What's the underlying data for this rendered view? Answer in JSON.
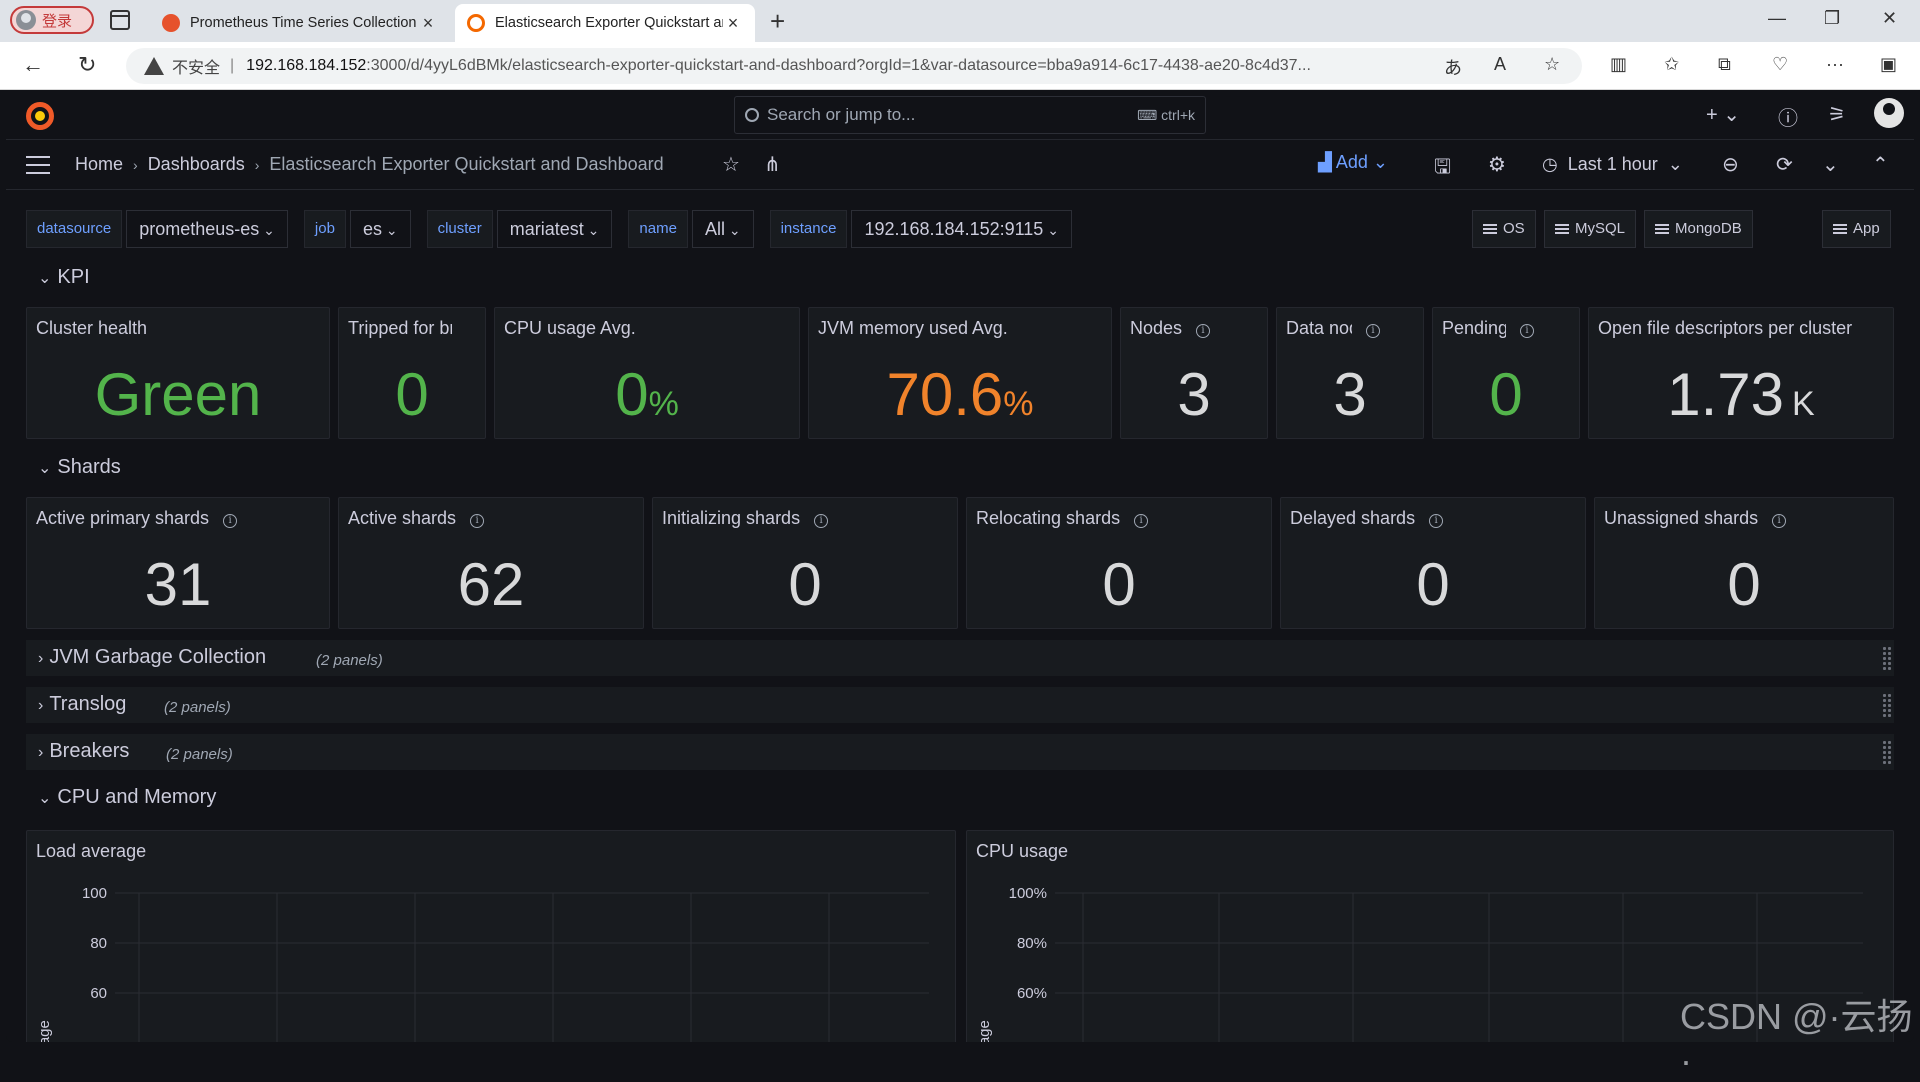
{
  "browser": {
    "profile_label": "登录",
    "tabs": [
      {
        "title": "Prometheus Time Series Collection"
      },
      {
        "title": "Elasticsearch Exporter Quickstart and Dashboard"
      }
    ],
    "insecure_label": "不安全",
    "url_host": "192.168.184.152",
    "url_rest": ":3000/d/4yyL6dBMk/elasticsearch-exporter-quickstart-and-dashboard?orgId=1&var-datasource=bba9a914-6c17-4438-ae20-8c4d37..."
  },
  "grafana": {
    "search_placeholder": "Search or jump to...",
    "search_shortcut": "ctrl+k",
    "breadcrumb": [
      "Home",
      "Dashboards",
      "Elasticsearch Exporter Quickstart and Dashboard"
    ],
    "add_label": "Add",
    "time_range": "Last 1 hour"
  },
  "variables": [
    {
      "label": "datasource",
      "value": "prometheus-es"
    },
    {
      "label": "job",
      "value": "es"
    },
    {
      "label": "cluster",
      "value": "mariatest"
    },
    {
      "label": "name",
      "value": "All"
    },
    {
      "label": "instance",
      "value": "192.168.184.152:9115"
    }
  ],
  "links": [
    "OS",
    "MySQL",
    "MongoDB",
    "App"
  ],
  "rows": {
    "kpi": "KPI",
    "shards": "Shards",
    "jvm": {
      "title": "JVM Garbage Collection",
      "count": "(2 panels)"
    },
    "translog": {
      "title": "Translog",
      "count": "(2 panels)"
    },
    "breakers": {
      "title": "Breakers",
      "count": "(2 panels)"
    },
    "cpu": "CPU and Memory"
  },
  "kpi_panels": [
    {
      "title": "Cluster health",
      "value": "Green",
      "unit": "",
      "color": "#53b44b"
    },
    {
      "title": "Tripped for breakers",
      "value": "0",
      "unit": "",
      "color": "#53b44b"
    },
    {
      "title": "CPU usage Avg.",
      "value": "0",
      "unit": "%",
      "color": "#53b44b"
    },
    {
      "title": "JVM memory used Avg.",
      "value": "70.6",
      "unit": "%",
      "color": "#f0832b"
    },
    {
      "title": "Nodes",
      "value": "3",
      "unit": "",
      "color": "#d8d9da"
    },
    {
      "title": "Data nodes",
      "value": "3",
      "unit": "",
      "color": "#d8d9da"
    },
    {
      "title": "Pending tasks",
      "value": "0",
      "unit": "",
      "color": "#53b44b"
    },
    {
      "title": "Open file descriptors per cluster",
      "value": "1.73",
      "unit": "K",
      "color": "#d8d9da"
    }
  ],
  "shard_panels": [
    {
      "title": "Active primary shards",
      "value": "31"
    },
    {
      "title": "Active shards",
      "value": "62"
    },
    {
      "title": "Initializing shards",
      "value": "0"
    },
    {
      "title": "Relocating shards",
      "value": "0"
    },
    {
      "title": "Delayed shards",
      "value": "0"
    },
    {
      "title": "Unassigned shards",
      "value": "0"
    }
  ],
  "chart_data": [
    {
      "type": "line",
      "title": "Load average",
      "ylabel": "usage",
      "yticks": [
        "100",
        "80",
        "60"
      ],
      "ylim": [
        40,
        100
      ],
      "series": []
    },
    {
      "type": "line",
      "title": "CPU usage",
      "ylabel": "usage",
      "yticks": [
        "100%",
        "80%",
        "60%"
      ],
      "ylim": [
        40,
        100
      ],
      "series": []
    }
  ],
  "watermark": "CSDN @·云扬·"
}
